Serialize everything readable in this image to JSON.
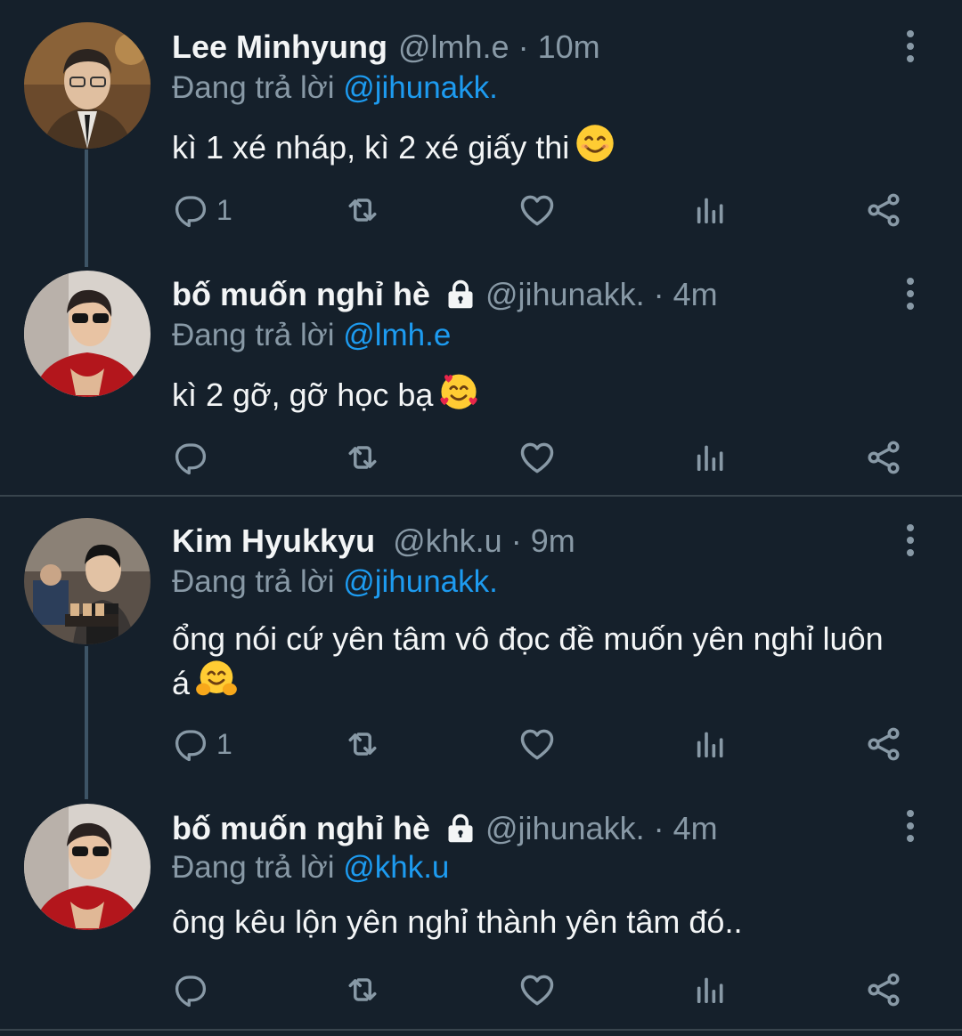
{
  "tweets": [
    {
      "name": "Lee Minhyung",
      "handle": "@lmh.e",
      "time": "10m",
      "locked": false,
      "replying_prefix": "Đang trả lời",
      "replying_to": "@jihunakk.",
      "text": "kì 1 xé nháp, kì 2 xé giấy thi",
      "emoji": "smiling-face",
      "reply_count": "1"
    },
    {
      "name": "bố muốn nghỉ hè",
      "handle": "@jihunakk.",
      "time": "4m",
      "locked": true,
      "replying_prefix": "Đang trả lời",
      "replying_to": "@lmh.e",
      "text": "kì 2 gỡ, gỡ học bạ",
      "emoji": "smiling-face-with-hearts",
      "reply_count": ""
    },
    {
      "name": "Kim Hyukkyu",
      "handle": "@khk.u",
      "time": "9m",
      "locked": false,
      "replying_prefix": "Đang trả lời",
      "replying_to": "@jihunakk.",
      "text": "ổng nói cứ yên tâm vô đọc đề muốn yên nghỉ luôn á",
      "emoji": "hugging-face",
      "reply_count": "1"
    },
    {
      "name": "bố muốn nghỉ hè",
      "handle": "@jihunakk.",
      "time": "4m",
      "locked": true,
      "replying_prefix": "Đang trả lời",
      "replying_to": "@khk.u",
      "text": "ông kêu lộn yên nghỉ thành yên tâm đó..",
      "emoji": "",
      "reply_count": ""
    }
  ],
  "separator": "·",
  "colors": {
    "background": "#15202b",
    "text": "#e7e9ea",
    "secondary": "#8899a6",
    "link": "#1d9bf0",
    "thread_line": "#3d5466",
    "divider": "#38444d"
  },
  "icons": [
    "reply-icon",
    "retweet-icon",
    "like-icon",
    "analytics-icon",
    "share-icon",
    "more-vertical-icon",
    "lock-icon"
  ]
}
